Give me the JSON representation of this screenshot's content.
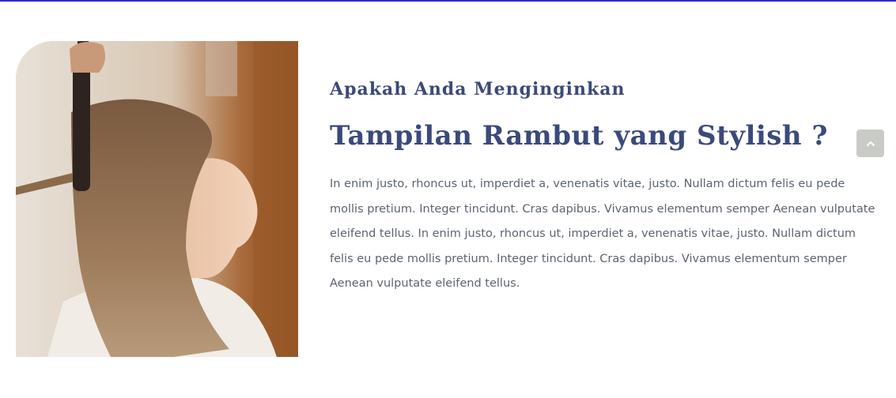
{
  "section": {
    "kicker": "Apakah Anda Menginginkan",
    "headline": "Tampilan Rambut yang Stylish ?",
    "paragraph": "In enim justo, rhoncus ut, imperdiet a, venenatis vitae, justo. Nullam dictum felis eu pede mollis pretium. Integer tincidunt. Cras dapibus. Vivamus elementum semper Aenean vulputate eleifend tellus. In enim justo, rhoncus ut, imperdiet a, venenatis vitae, justo. Nullam dictum felis eu pede mollis pretium. Integer tincidunt. Cras dapibus. Vivamus elementum semper Aenean vulputate eleifend tellus."
  },
  "image": {
    "subject": "woman having hair curled with a curling iron"
  },
  "scroll_top": {
    "icon": "chevron-up-icon"
  },
  "colors": {
    "heading": "#3b4a7a",
    "body": "#5c6470",
    "top_border": "#2b2bd9",
    "scroll_button": "#c9ccc6"
  }
}
